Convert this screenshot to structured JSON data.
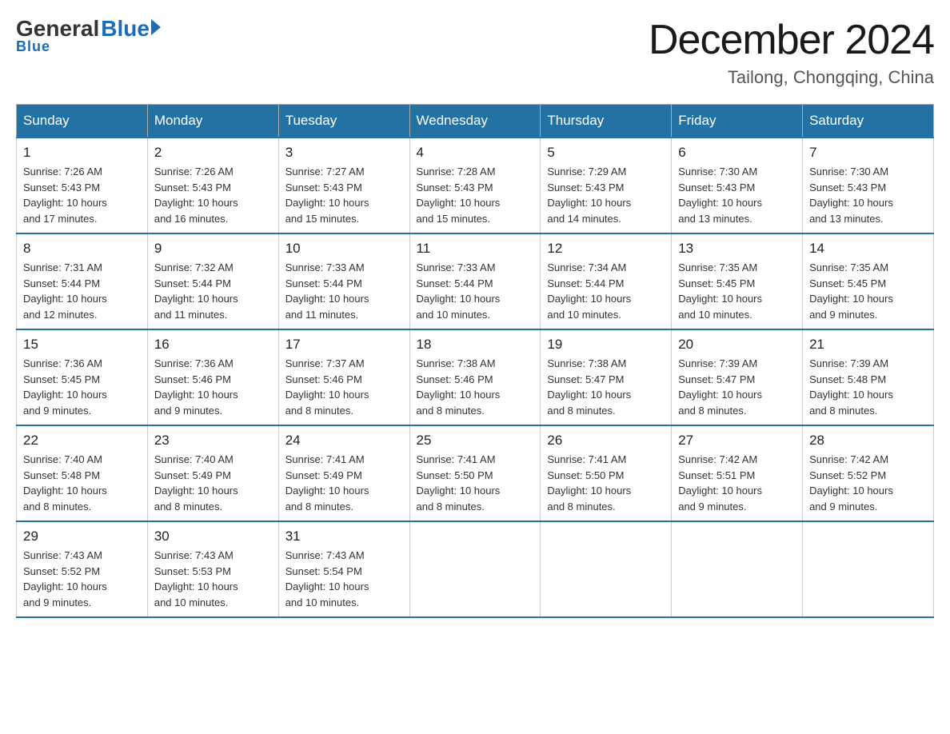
{
  "header": {
    "logo_general": "General",
    "logo_blue": "Blue",
    "month_title": "December 2024",
    "subtitle": "Tailong, Chongqing, China"
  },
  "days_of_week": [
    "Sunday",
    "Monday",
    "Tuesday",
    "Wednesday",
    "Thursday",
    "Friday",
    "Saturday"
  ],
  "weeks": [
    [
      {
        "date": "1",
        "sunrise": "7:26 AM",
        "sunset": "5:43 PM",
        "daylight": "10 hours and 17 minutes."
      },
      {
        "date": "2",
        "sunrise": "7:26 AM",
        "sunset": "5:43 PM",
        "daylight": "10 hours and 16 minutes."
      },
      {
        "date": "3",
        "sunrise": "7:27 AM",
        "sunset": "5:43 PM",
        "daylight": "10 hours and 15 minutes."
      },
      {
        "date": "4",
        "sunrise": "7:28 AM",
        "sunset": "5:43 PM",
        "daylight": "10 hours and 15 minutes."
      },
      {
        "date": "5",
        "sunrise": "7:29 AM",
        "sunset": "5:43 PM",
        "daylight": "10 hours and 14 minutes."
      },
      {
        "date": "6",
        "sunrise": "7:30 AM",
        "sunset": "5:43 PM",
        "daylight": "10 hours and 13 minutes."
      },
      {
        "date": "7",
        "sunrise": "7:30 AM",
        "sunset": "5:43 PM",
        "daylight": "10 hours and 13 minutes."
      }
    ],
    [
      {
        "date": "8",
        "sunrise": "7:31 AM",
        "sunset": "5:44 PM",
        "daylight": "10 hours and 12 minutes."
      },
      {
        "date": "9",
        "sunrise": "7:32 AM",
        "sunset": "5:44 PM",
        "daylight": "10 hours and 11 minutes."
      },
      {
        "date": "10",
        "sunrise": "7:33 AM",
        "sunset": "5:44 PM",
        "daylight": "10 hours and 11 minutes."
      },
      {
        "date": "11",
        "sunrise": "7:33 AM",
        "sunset": "5:44 PM",
        "daylight": "10 hours and 10 minutes."
      },
      {
        "date": "12",
        "sunrise": "7:34 AM",
        "sunset": "5:44 PM",
        "daylight": "10 hours and 10 minutes."
      },
      {
        "date": "13",
        "sunrise": "7:35 AM",
        "sunset": "5:45 PM",
        "daylight": "10 hours and 10 minutes."
      },
      {
        "date": "14",
        "sunrise": "7:35 AM",
        "sunset": "5:45 PM",
        "daylight": "10 hours and 9 minutes."
      }
    ],
    [
      {
        "date": "15",
        "sunrise": "7:36 AM",
        "sunset": "5:45 PM",
        "daylight": "10 hours and 9 minutes."
      },
      {
        "date": "16",
        "sunrise": "7:36 AM",
        "sunset": "5:46 PM",
        "daylight": "10 hours and 9 minutes."
      },
      {
        "date": "17",
        "sunrise": "7:37 AM",
        "sunset": "5:46 PM",
        "daylight": "10 hours and 8 minutes."
      },
      {
        "date": "18",
        "sunrise": "7:38 AM",
        "sunset": "5:46 PM",
        "daylight": "10 hours and 8 minutes."
      },
      {
        "date": "19",
        "sunrise": "7:38 AM",
        "sunset": "5:47 PM",
        "daylight": "10 hours and 8 minutes."
      },
      {
        "date": "20",
        "sunrise": "7:39 AM",
        "sunset": "5:47 PM",
        "daylight": "10 hours and 8 minutes."
      },
      {
        "date": "21",
        "sunrise": "7:39 AM",
        "sunset": "5:48 PM",
        "daylight": "10 hours and 8 minutes."
      }
    ],
    [
      {
        "date": "22",
        "sunrise": "7:40 AM",
        "sunset": "5:48 PM",
        "daylight": "10 hours and 8 minutes."
      },
      {
        "date": "23",
        "sunrise": "7:40 AM",
        "sunset": "5:49 PM",
        "daylight": "10 hours and 8 minutes."
      },
      {
        "date": "24",
        "sunrise": "7:41 AM",
        "sunset": "5:49 PM",
        "daylight": "10 hours and 8 minutes."
      },
      {
        "date": "25",
        "sunrise": "7:41 AM",
        "sunset": "5:50 PM",
        "daylight": "10 hours and 8 minutes."
      },
      {
        "date": "26",
        "sunrise": "7:41 AM",
        "sunset": "5:50 PM",
        "daylight": "10 hours and 8 minutes."
      },
      {
        "date": "27",
        "sunrise": "7:42 AM",
        "sunset": "5:51 PM",
        "daylight": "10 hours and 9 minutes."
      },
      {
        "date": "28",
        "sunrise": "7:42 AM",
        "sunset": "5:52 PM",
        "daylight": "10 hours and 9 minutes."
      }
    ],
    [
      {
        "date": "29",
        "sunrise": "7:43 AM",
        "sunset": "5:52 PM",
        "daylight": "10 hours and 9 minutes."
      },
      {
        "date": "30",
        "sunrise": "7:43 AM",
        "sunset": "5:53 PM",
        "daylight": "10 hours and 10 minutes."
      },
      {
        "date": "31",
        "sunrise": "7:43 AM",
        "sunset": "5:54 PM",
        "daylight": "10 hours and 10 minutes."
      },
      null,
      null,
      null,
      null
    ]
  ],
  "labels": {
    "sunrise": "Sunrise:",
    "sunset": "Sunset:",
    "daylight": "Daylight:"
  }
}
